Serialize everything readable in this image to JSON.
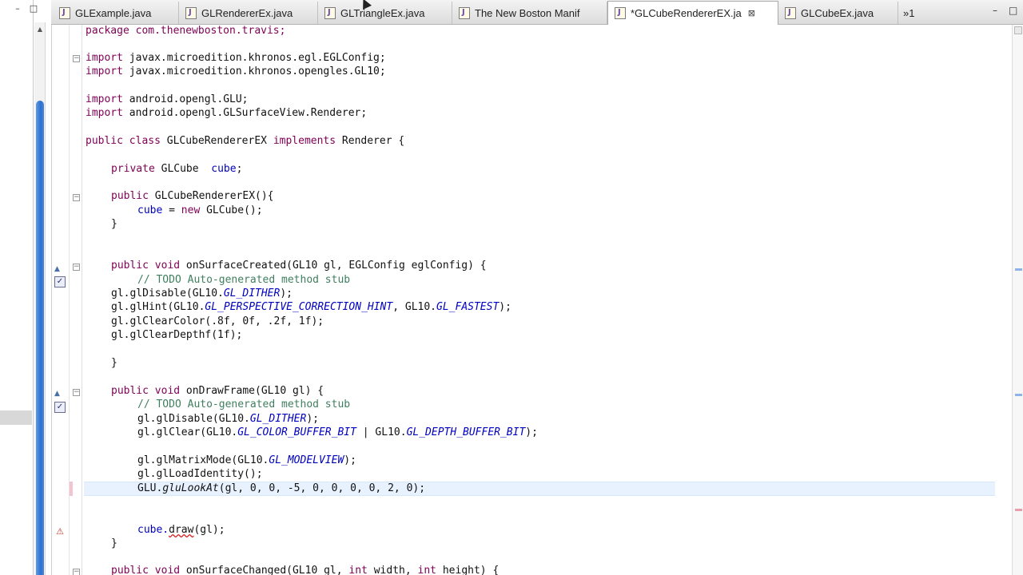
{
  "left_panel": {
    "minimize_glyph": "–",
    "maximize_glyph": "□"
  },
  "tabs": [
    {
      "label": "GLExample.java"
    },
    {
      "label": "GLRendererEx.java"
    },
    {
      "label": "GLTriangleEx.java"
    },
    {
      "label": "The New Boston Manif"
    },
    {
      "label": "*GLCubeRendererEX.ja",
      "active": true,
      "close": "⊠"
    },
    {
      "label": "GLCubeEx.java"
    }
  ],
  "tab_overflow": "»1",
  "window_controls": {
    "minimize": "–",
    "maximize": "□"
  },
  "icons": {
    "file": "java-file-icon",
    "fold": "fold-toggle-icon",
    "task": "task-marker-icon",
    "override": "override-arrow-icon",
    "error": "error-lightbulb-icon"
  },
  "colors": {
    "keyword": "#7f0055",
    "comment": "#3f7f5f",
    "field": "#0000c0",
    "current_line": "#e8f2fe",
    "scroll_thumb": "#2f6fcf"
  },
  "code": {
    "l1": "package com.thenewboston.travis;",
    "l2_kw": "import",
    "l2_rest": " javax.microedition.khronos.egl.EGLConfig;",
    "l3_kw": "import",
    "l3_rest": " javax.microedition.khronos.opengles.GL10;",
    "l4_kw": "import",
    "l4_rest": " android.opengl.GLU;",
    "l5_kw": "import",
    "l5_rest": " android.opengl.GLSurfaceView.Renderer;",
    "l6_kw1": "public class",
    "l6_mid": " GLCubeRendererEX ",
    "l6_kw2": "implements",
    "l6_rest": " Renderer {",
    "l7_kw": "private",
    "l7_mid": " GLCube  ",
    "l7_field": "cube",
    "l7_end": ";",
    "l8_kw": "public",
    "l8_rest": " GLCubeRendererEX(){",
    "l9_field": "cube",
    "l9_mid": " = ",
    "l9_kw": "new",
    "l9_rest": " GLCube();",
    "l10": "}",
    "l11_kw": "public void",
    "l11_rest": " onSurfaceCreated(GL10 gl, EGLConfig eglConfig) {",
    "l12": "// TODO Auto-generated method stub",
    "l13_a": "gl.glDisable(GL10.",
    "l13_f": "GL_DITHER",
    "l13_b": ");",
    "l14_a": "gl.glHint(GL10.",
    "l14_f1": "GL_PERSPECTIVE_CORRECTION_HINT",
    "l14_b": ", GL10.",
    "l14_f2": "GL_FASTEST",
    "l14_c": ");",
    "l15": "gl.glClearColor(.8f, 0f, .2f, 1f);",
    "l16": "gl.glClearDepthf(1f);",
    "l17": "}",
    "l18_kw": "public void",
    "l18_rest": " onDrawFrame(GL10 gl) {",
    "l19": "// TODO Auto-generated method stub",
    "l20_a": "gl.glDisable(GL10.",
    "l20_f": "GL_DITHER",
    "l20_b": ");",
    "l21_a": "gl.glClear(GL10.",
    "l21_f1": "GL_COLOR_BUFFER_BIT",
    "l21_b": " | GL10.",
    "l21_f2": "GL_DEPTH_BUFFER_BIT",
    "l21_c": ");",
    "l22_a": "gl.glMatrixMode(GL10.",
    "l22_f": "GL_MODELVIEW",
    "l22_b": ");",
    "l23": "gl.glLoadIdentity();",
    "l24_a": "GLU.",
    "l24_i": "gluLookAt",
    "l24_b": "(gl, 0, 0, -5, 0, 0, 0, 0, 2, 0);",
    "l25_a": "cube.",
    "l25_e": "draw",
    "l25_b": "(gl);",
    "l26": "}",
    "l27_kw": "public void",
    "l27_rest": " onSurfaceChanged(GL10 gl, ",
    "l27_kw2": "int",
    "l27_mid": " width, ",
    "l27_kw3": "int",
    "l27_end": " height) {"
  }
}
